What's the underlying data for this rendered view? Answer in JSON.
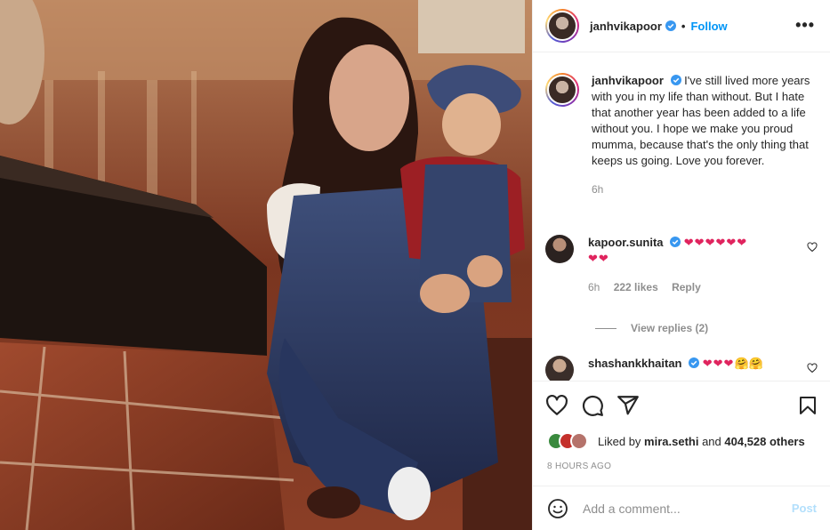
{
  "post": {
    "username": "janhvikapoor",
    "follow_label": "Follow",
    "separator": "•",
    "more_label": "•••",
    "caption": "I've still lived more years with you in my life than without. But I hate that another year has been added to a life without you. I hope we make you proud mumma, because that's the only thing that keeps us going. Love you forever.",
    "caption_time": "6h",
    "photo_icon": "family-photo"
  },
  "comments": [
    {
      "username": "kapoor.sunita",
      "text": "❤❤❤❤❤❤",
      "text2": "❤❤",
      "time": "6h",
      "likes": "222 likes",
      "reply_label": "Reply"
    },
    {
      "username": "shashankkhaitan",
      "text": "❤❤❤",
      "emoji": "🤗🤗"
    }
  ],
  "view_replies": "View replies (2)",
  "likes": {
    "prefix": "Liked by ",
    "user": "mira.sethi",
    "middle": " and ",
    "count": "404,528 others"
  },
  "timestamp": "8 HOURS AGO",
  "add_comment": {
    "placeholder": "Add a comment...",
    "post_label": "Post"
  },
  "colors": {
    "accent": "#0095f6",
    "verified": "#3897f0",
    "heart": "#e0245e",
    "muted": "#8e8e8e"
  }
}
